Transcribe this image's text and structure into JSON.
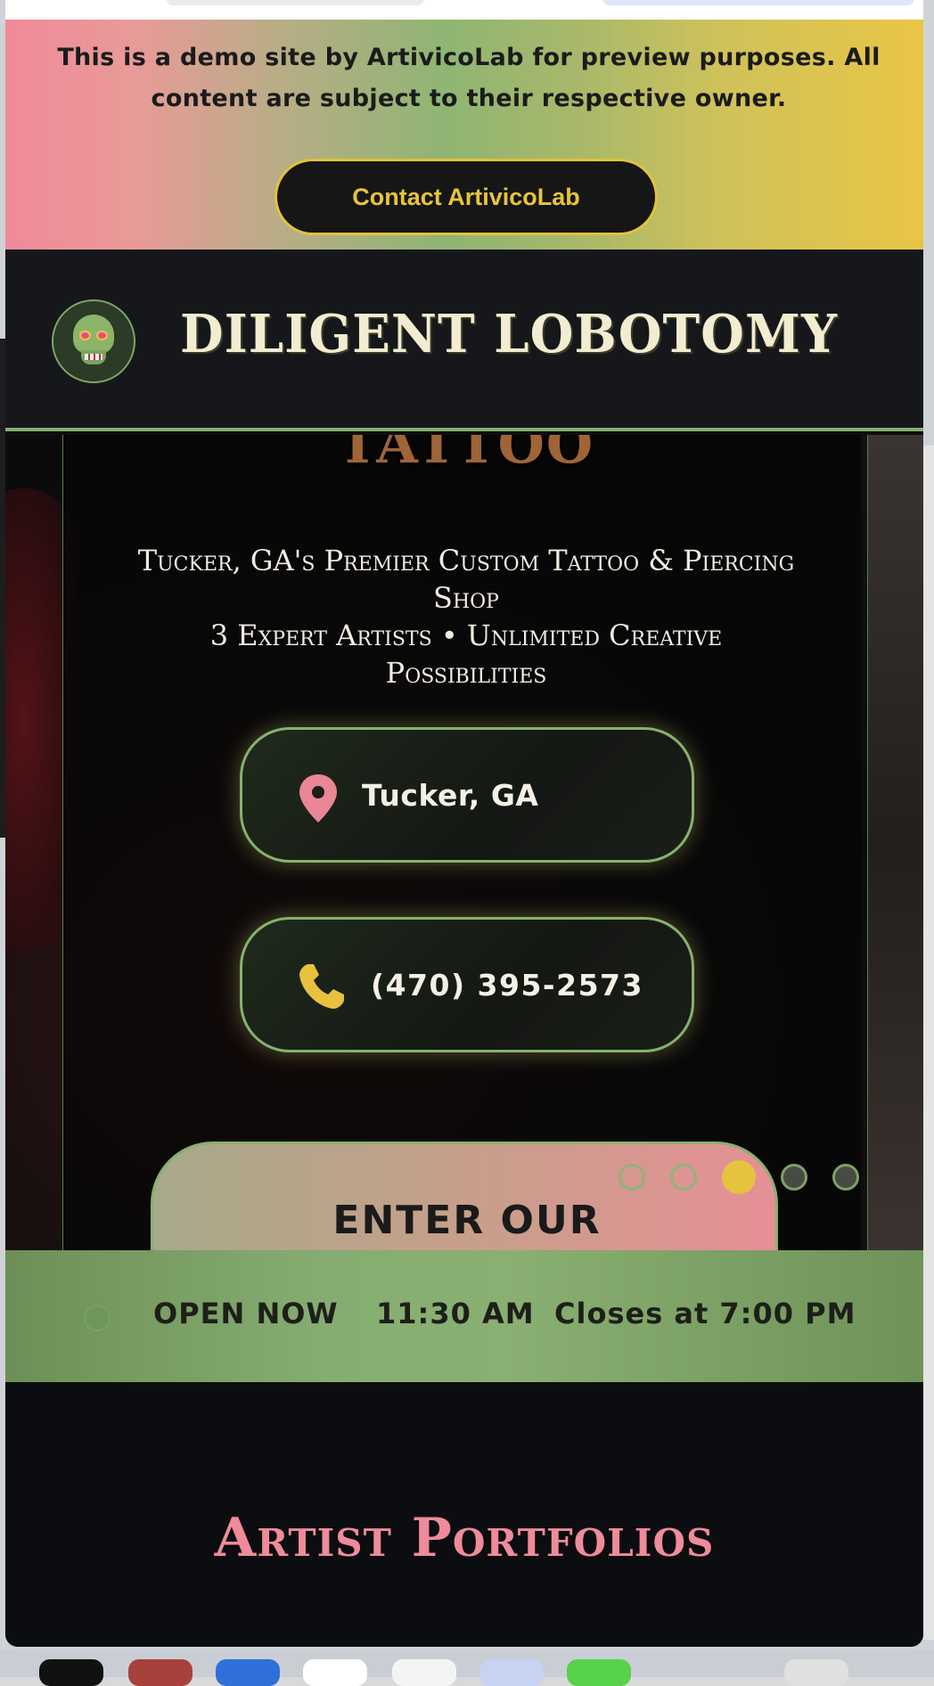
{
  "demo_banner": {
    "message": "This is a demo site by ArtivicoLab for preview purposes. All content are subject to their respective owner.",
    "contact_label": "Contact ArtivicoLab"
  },
  "header": {
    "brand": "DILIGENT LOBOTOMY"
  },
  "hero": {
    "heading_fragment": "TATTOO",
    "tagline_line1": "Tucker, GA's Premier Custom Tattoo & Piercing Shop",
    "tagline_line2": "3 Expert Artists • Unlimited Creative Possibilities",
    "location_label": "Tucker, GA",
    "phone_label": "(470) 395-2573",
    "enter_label": "ENTER OUR",
    "slides": {
      "count": 5,
      "active_index": 3
    }
  },
  "hours": {
    "status": "OPEN NOW",
    "time": "11:30 AM",
    "closing": "Closes at 7:00 PM"
  },
  "portfolio": {
    "title": "Artist Portfolios"
  },
  "colors": {
    "accent_green": "#86b26c",
    "accent_gold": "#e6c33f",
    "accent_pink": "#ef8b9a",
    "background_dark": "#16171a"
  },
  "icons": {
    "logo": "skull-icon",
    "location": "map-pin-icon",
    "phone": "phone-icon"
  }
}
